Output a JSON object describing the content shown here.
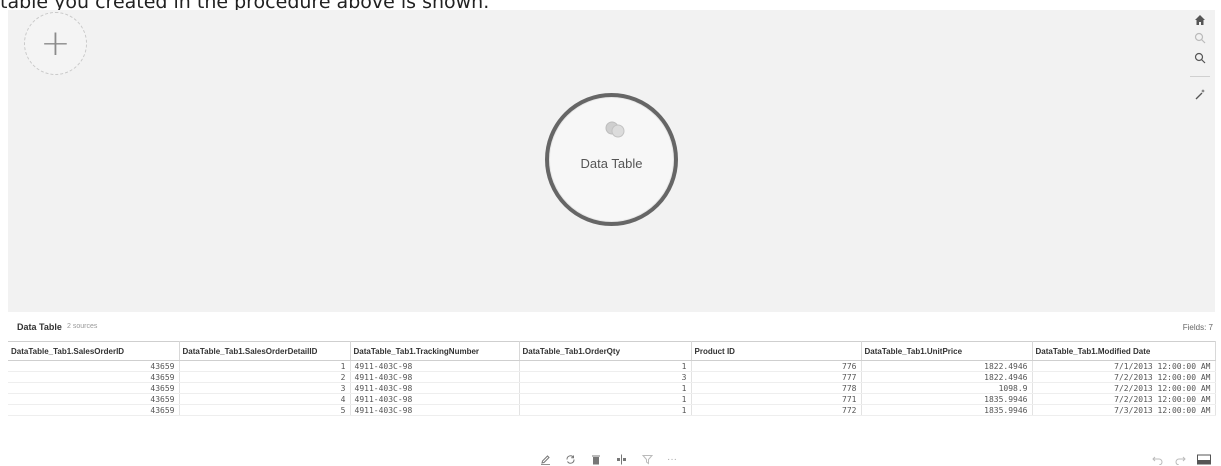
{
  "caption": "table you created in the procedure above is shown.",
  "canvas": {
    "add_label": "+",
    "node_label": "Data Table"
  },
  "toolrail": {
    "home_icon": "home-icon",
    "zoom_out_icon": "zoom-out-icon",
    "zoom_in_icon": "zoom-in-icon",
    "auto_layout_icon": "magic-wand-icon"
  },
  "panel": {
    "title": "Data Table",
    "sources": "2 sources",
    "fields": "Fields: 7"
  },
  "table": {
    "columns": [
      "DataTable_Tab1.SalesOrderID",
      "DataTable_Tab1.SalesOrderDetailID",
      "DataTable_Tab1.TrackingNumber",
      "DataTable_Tab1.OrderQty",
      "Product ID",
      "DataTable_Tab1.UnitPrice",
      "DataTable_Tab1.Modified Date"
    ],
    "rows": [
      [
        "43659",
        "1",
        "4911-403C-98",
        "1",
        "776",
        "1822.4946",
        "7/1/2013 12:00:00 AM"
      ],
      [
        "43659",
        "2",
        "4911-403C-98",
        "3",
        "777",
        "1822.4946",
        "7/2/2013 12:00:00 AM"
      ],
      [
        "43659",
        "3",
        "4911-403C-98",
        "1",
        "778",
        "1098.9",
        "7/2/2013 12:00:00 AM"
      ],
      [
        "43659",
        "4",
        "4911-403C-98",
        "1",
        "771",
        "1835.9946",
        "7/2/2013 12:00:00 AM"
      ],
      [
        "43659",
        "5",
        "4911-403C-98",
        "1",
        "772",
        "1835.9946",
        "7/3/2013 12:00:00 AM"
      ]
    ]
  },
  "bottom_toolbar": {
    "edit_icon": "pencil-icon",
    "refresh_icon": "refresh-icon",
    "delete_icon": "trash-icon",
    "split_icon": "split-icon",
    "filter_icon": "filter-icon",
    "more_label": "···",
    "undo_icon": "undo-icon",
    "redo_icon": "redo-icon",
    "panel_toggle_icon": "panel-toggle-icon"
  }
}
